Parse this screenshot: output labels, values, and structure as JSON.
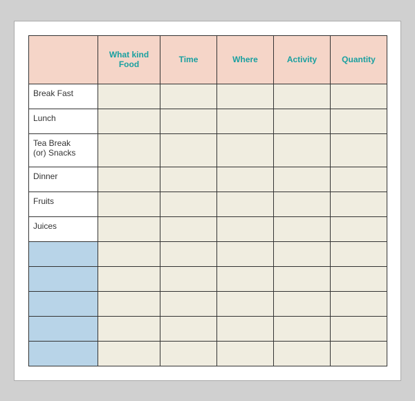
{
  "header": {
    "col1_label": "",
    "col2_line1": "What kind",
    "col2_line2": "Food",
    "col3_label": "Time",
    "col4_label": "Where",
    "col5_label": "Activity",
    "col6_label": "Quantity"
  },
  "rows": [
    {
      "label": "Break Fast",
      "type": "normal"
    },
    {
      "label": "Lunch",
      "type": "normal"
    },
    {
      "label": "Tea Break\n(or) Snacks",
      "type": "tall"
    },
    {
      "label": "Dinner",
      "type": "normal"
    },
    {
      "label": "Fruits",
      "type": "normal"
    },
    {
      "label": "Juices",
      "type": "normal"
    },
    {
      "label": "",
      "type": "blue"
    },
    {
      "label": "",
      "type": "blue"
    },
    {
      "label": "",
      "type": "blue"
    },
    {
      "label": "",
      "type": "blue"
    },
    {
      "label": "",
      "type": "blue"
    }
  ]
}
